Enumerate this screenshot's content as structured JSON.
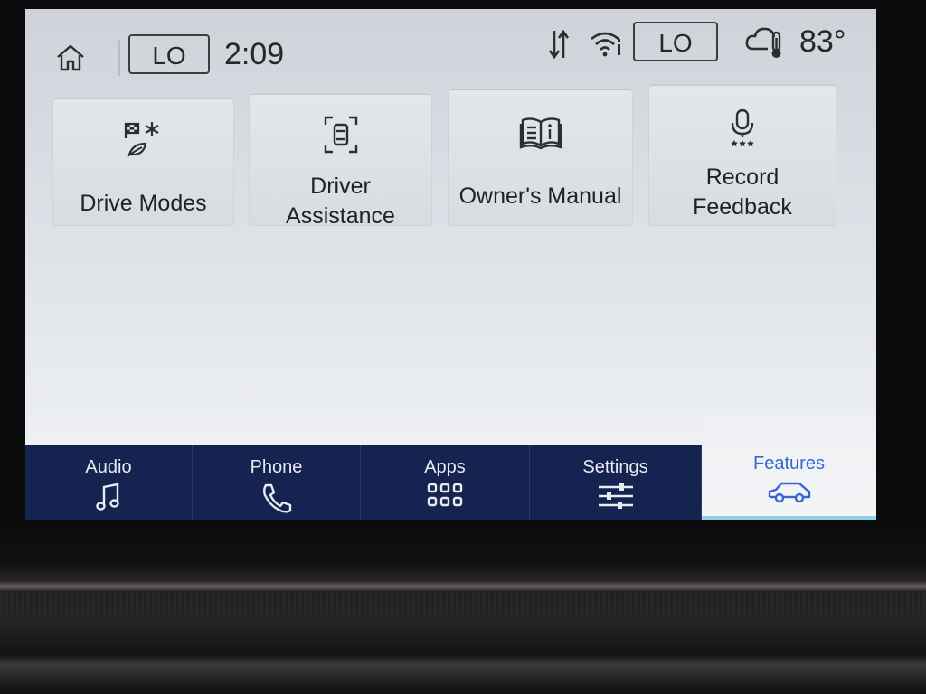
{
  "status_bar": {
    "home_icon": "home-icon",
    "left_climate": "LO",
    "time": "2:09",
    "sync_icon": "data-sync-icon",
    "wifi_icon": "wifi-info-icon",
    "right_climate": "LO",
    "weather_icon": "cloud-thermometer-icon",
    "temperature": "83°"
  },
  "tiles": [
    {
      "label_lines": [
        "Drive Modes"
      ],
      "icon": "drive-modes-icon"
    },
    {
      "label_lines": [
        "Driver",
        "Assistance"
      ],
      "icon": "driver-assistance-icon"
    },
    {
      "label_lines": [
        "Owner's Manual"
      ],
      "icon": "owners-manual-icon"
    },
    {
      "label_lines": [
        "Record",
        "Feedback"
      ],
      "icon": "microphone-icon"
    }
  ],
  "nav": [
    {
      "label": "Audio",
      "icon": "music-note-icon"
    },
    {
      "label": "Phone",
      "icon": "phone-icon"
    },
    {
      "label": "Apps",
      "icon": "apps-grid-icon"
    },
    {
      "label": "Settings",
      "icon": "sliders-icon"
    },
    {
      "label": "Features",
      "icon": "car-icon",
      "active": true
    }
  ],
  "colors": {
    "nav_bg": "#14234f",
    "active_accent": "#3466d8",
    "active_underline": "#8fd1e8"
  }
}
